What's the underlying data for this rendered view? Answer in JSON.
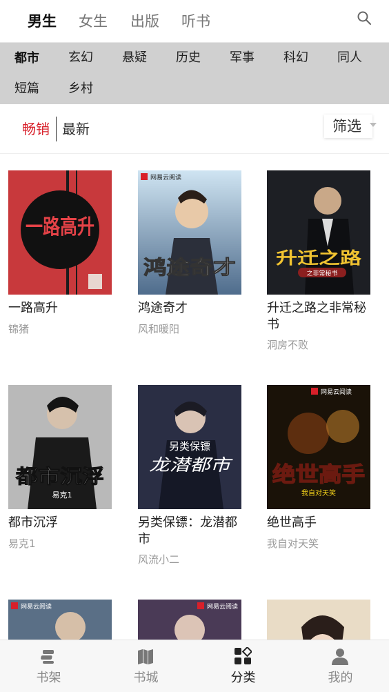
{
  "top_tabs": [
    {
      "label": "男生",
      "active": true
    },
    {
      "label": "女生",
      "active": false
    },
    {
      "label": "出版",
      "active": false
    },
    {
      "label": "听书",
      "active": false
    }
  ],
  "search_icon": "search-icon",
  "categories": [
    {
      "label": "都市",
      "active": true
    },
    {
      "label": "玄幻"
    },
    {
      "label": "悬疑"
    },
    {
      "label": "历史"
    },
    {
      "label": "军事"
    },
    {
      "label": "科幻"
    },
    {
      "label": "同人"
    },
    {
      "label": "短篇"
    },
    {
      "label": "乡村"
    }
  ],
  "sort": {
    "bestselling": "畅销",
    "newest": "最新",
    "filter": "筛选"
  },
  "books": [
    {
      "title": "一路高升",
      "author": "锦猪",
      "cover_text": "一路高升",
      "cover_color": "#c8393c"
    },
    {
      "title": "鸿途奇才",
      "author": "风和暖阳",
      "cover_text": "鸿途奇才",
      "cover_color": "#8fb7d8"
    },
    {
      "title": "升迁之路之非常秘书",
      "author": "洞房不败",
      "cover_text": "升迁之路",
      "cover_subtext": "之非常秘书",
      "cover_color": "#1d1f24"
    },
    {
      "title": "都市沉浮",
      "author": "易克1",
      "cover_text": "都市沉浮",
      "cover_color": "#b9b9b9"
    },
    {
      "title": "另类保镖：龙潜都市",
      "author": "风流小二",
      "cover_text": "龙潜都市",
      "cover_subtext": "另类保镖",
      "cover_color": "#2a2e44"
    },
    {
      "title": "绝世高手",
      "author": "我自对天笑",
      "cover_text": "绝世高手",
      "cover_color": "#1a1208"
    },
    {
      "title": "",
      "author": "",
      "cover_text": "",
      "cover_color": "#5a6f86"
    },
    {
      "title": "",
      "author": "",
      "cover_text": "",
      "cover_color": "#4a3a56"
    },
    {
      "title": "",
      "author": "",
      "cover_text": "",
      "cover_color": "#e9dcc6"
    }
  ],
  "publisher_badge": "网易云阅读",
  "bottom_nav": [
    {
      "label": "书架",
      "icon": "bookshelf-icon",
      "active": false
    },
    {
      "label": "书城",
      "icon": "book-city-icon",
      "active": false
    },
    {
      "label": "分类",
      "icon": "category-icon",
      "active": true
    },
    {
      "label": "我的",
      "icon": "profile-icon",
      "active": false
    }
  ]
}
